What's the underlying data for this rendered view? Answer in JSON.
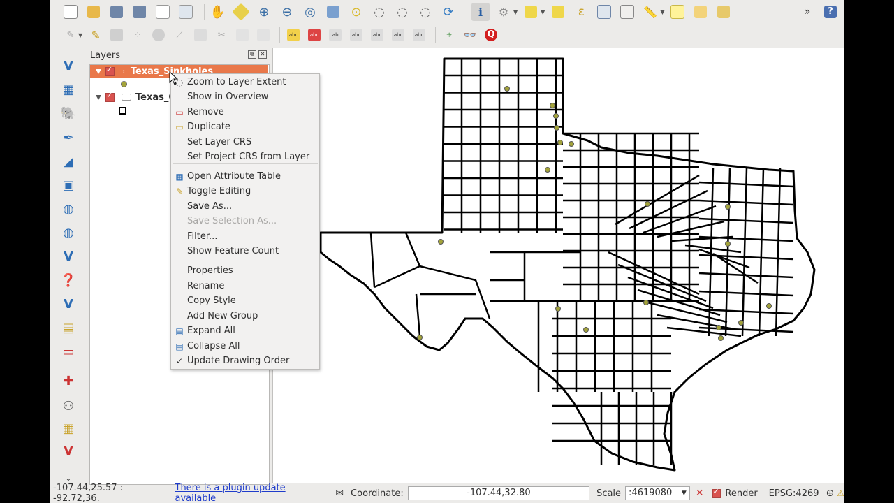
{
  "layers_panel": {
    "title": "Layers",
    "layers": [
      {
        "name": "Texas_Sinkholes",
        "symbol": "point"
      },
      {
        "name": "Texas_C",
        "symbol": "polygon"
      }
    ]
  },
  "context_menu": {
    "items": [
      {
        "label": "Zoom to Layer Extent",
        "icon": "zoom-layer-icon",
        "enabled": true
      },
      {
        "label": "Show in Overview",
        "icon": "",
        "enabled": true
      },
      {
        "label": "Remove",
        "icon": "remove-icon",
        "enabled": true
      },
      {
        "label": "Duplicate",
        "icon": "duplicate-icon",
        "enabled": true
      },
      {
        "label": "Set Layer CRS",
        "icon": "",
        "enabled": true
      },
      {
        "label": "Set Project CRS from Layer",
        "icon": "",
        "enabled": true
      },
      {
        "label": "Open Attribute Table",
        "icon": "table-icon",
        "enabled": true
      },
      {
        "label": "Toggle Editing",
        "icon": "pencil-icon",
        "enabled": true
      },
      {
        "label": "Save As...",
        "icon": "",
        "enabled": true
      },
      {
        "label": "Save Selection As...",
        "icon": "",
        "enabled": false
      },
      {
        "label": "Filter...",
        "icon": "",
        "enabled": true
      },
      {
        "label": "Show Feature Count",
        "icon": "",
        "enabled": true
      },
      {
        "label": "Properties",
        "icon": "",
        "enabled": true
      },
      {
        "label": "Rename",
        "icon": "",
        "enabled": true
      },
      {
        "label": "Copy Style",
        "icon": "",
        "enabled": true
      },
      {
        "label": "Add New Group",
        "icon": "",
        "enabled": true
      },
      {
        "label": "Expand All",
        "icon": "expand-icon",
        "enabled": true
      },
      {
        "label": "Collapse All",
        "icon": "collapse-icon",
        "enabled": true
      },
      {
        "label": "Update Drawing Order",
        "icon": "check-icon",
        "enabled": true
      }
    ]
  },
  "statusbar": {
    "extent": "-107.44,25.57 : -92.72,36.",
    "plugin_link": "There is a plugin update available",
    "coordinate_label": "Coordinate:",
    "coordinate_value": "-107.44,32.80",
    "scale_label": "Scale",
    "scale_value": ":4619080",
    "render_label": "Render",
    "crs": "EPSG:4269"
  },
  "colors": {
    "selected_layer": "#e9784a",
    "sinkhole_point": "#a3a33a",
    "county_stroke": "#000000"
  }
}
